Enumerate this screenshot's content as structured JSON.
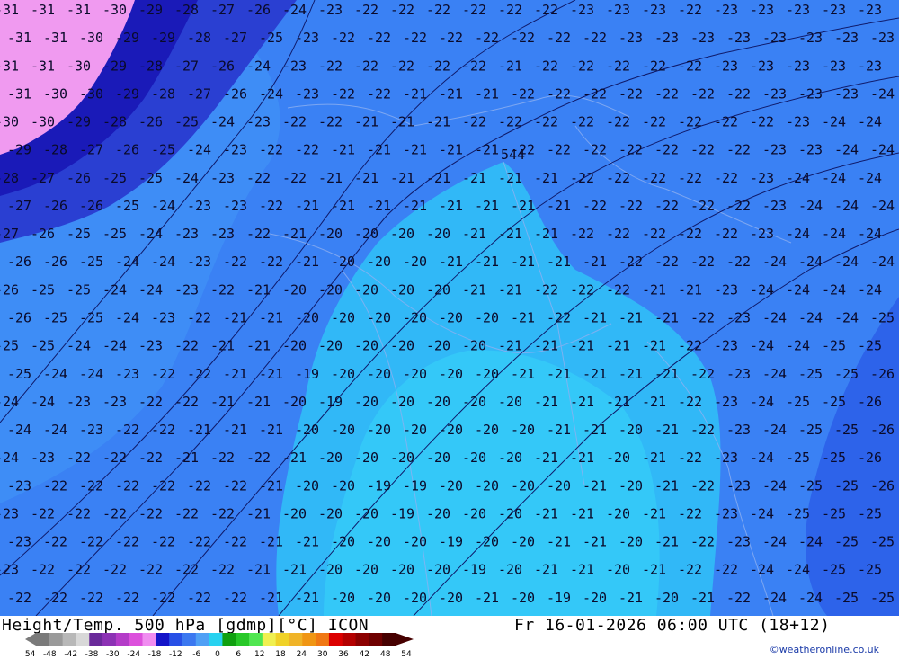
{
  "title": {
    "left": "Height/Temp. 500 hPa [gdmp][°C] ICON",
    "right": "Fr 16-01-2026 06:00 UTC (18+12)"
  },
  "credit": "©weatheronline.co.uk",
  "map_labels": {
    "center_contour": "544"
  },
  "scale": {
    "ticks": [
      "-54",
      "-48",
      "-42",
      "-38",
      "-30",
      "-24",
      "-18",
      "-12",
      "-6",
      "0",
      "6",
      "12",
      "18",
      "24",
      "30",
      "36",
      "42",
      "48",
      "54"
    ],
    "colors": [
      "#7a7a7a",
      "#9a9a9a",
      "#b8b8b8",
      "#d8d8d8",
      "#6a2a9a",
      "#8c32b4",
      "#b43cc8",
      "#dc50dc",
      "#f08cf0",
      "#1414c8",
      "#2850e6",
      "#3c78f0",
      "#50a0f5",
      "#28d2f0",
      "#10a010",
      "#28c828",
      "#50e650",
      "#f0f050",
      "#f0d228",
      "#f0b428",
      "#f09614",
      "#f07814",
      "#dc0000",
      "#b40000",
      "#8c0000",
      "#6e0000",
      "#460000"
    ]
  },
  "temperature_field": {
    "unit": "°C",
    "rows": [
      [
        "31",
        "31",
        "31",
        "30",
        "29",
        "28",
        "27",
        "26",
        "24",
        "23",
        "22",
        "22",
        "22",
        "22",
        "22",
        "22",
        "23",
        "23",
        "23",
        "22",
        "23",
        "23",
        "23",
        "23",
        "23"
      ],
      [
        "31",
        "31",
        "30",
        "29",
        "29",
        "28",
        "27",
        "25",
        "23",
        "22",
        "22",
        "22",
        "22",
        "22",
        "22",
        "22",
        "22",
        "23",
        "23",
        "23",
        "23",
        "23",
        "23",
        "23",
        "23"
      ],
      [
        "31",
        "31",
        "30",
        "29",
        "28",
        "27",
        "26",
        "24",
        "23",
        "22",
        "22",
        "22",
        "22",
        "22",
        "21",
        "22",
        "22",
        "22",
        "22",
        "22",
        "23",
        "23",
        "23",
        "23",
        "23"
      ],
      [
        "31",
        "30",
        "30",
        "29",
        "28",
        "27",
        "26",
        "24",
        "23",
        "22",
        "22",
        "21",
        "21",
        "21",
        "22",
        "22",
        "22",
        "22",
        "22",
        "22",
        "22",
        "23",
        "23",
        "23",
        "24"
      ],
      [
        "30",
        "30",
        "29",
        "28",
        "26",
        "25",
        "24",
        "23",
        "22",
        "22",
        "21",
        "21",
        "21",
        "22",
        "22",
        "22",
        "22",
        "22",
        "22",
        "22",
        "22",
        "22",
        "23",
        "24",
        "24"
      ],
      [
        "29",
        "28",
        "27",
        "26",
        "25",
        "24",
        "23",
        "22",
        "22",
        "21",
        "21",
        "21",
        "21",
        "21",
        "22",
        "22",
        "22",
        "22",
        "22",
        "22",
        "22",
        "23",
        "23",
        "24",
        "24"
      ],
      [
        "28",
        "27",
        "26",
        "25",
        "25",
        "24",
        "23",
        "22",
        "22",
        "21",
        "21",
        "21",
        "21",
        "21",
        "21",
        "21",
        "22",
        "22",
        "22",
        "22",
        "22",
        "23",
        "24",
        "24",
        "24"
      ],
      [
        "27",
        "26",
        "26",
        "25",
        "24",
        "23",
        "23",
        "22",
        "21",
        "21",
        "21",
        "21",
        "21",
        "21",
        "21",
        "21",
        "22",
        "22",
        "22",
        "22",
        "22",
        "23",
        "24",
        "24",
        "24"
      ],
      [
        "27",
        "26",
        "25",
        "25",
        "24",
        "23",
        "23",
        "22",
        "21",
        "20",
        "20",
        "20",
        "20",
        "21",
        "21",
        "21",
        "22",
        "22",
        "22",
        "22",
        "22",
        "23",
        "24",
        "24",
        "24"
      ],
      [
        "26",
        "26",
        "25",
        "24",
        "24",
        "23",
        "22",
        "22",
        "21",
        "20",
        "20",
        "20",
        "21",
        "21",
        "21",
        "21",
        "21",
        "22",
        "22",
        "22",
        "22",
        "24",
        "24",
        "24",
        "24"
      ],
      [
        "26",
        "25",
        "25",
        "24",
        "24",
        "23",
        "22",
        "21",
        "20",
        "20",
        "20",
        "20",
        "20",
        "21",
        "21",
        "22",
        "22",
        "22",
        "21",
        "21",
        "23",
        "24",
        "24",
        "24",
        "24"
      ],
      [
        "26",
        "25",
        "25",
        "24",
        "23",
        "22",
        "21",
        "21",
        "20",
        "20",
        "20",
        "20",
        "20",
        "20",
        "21",
        "22",
        "21",
        "21",
        "21",
        "22",
        "23",
        "24",
        "24",
        "24",
        "25"
      ],
      [
        "25",
        "25",
        "24",
        "24",
        "23",
        "22",
        "21",
        "21",
        "20",
        "20",
        "20",
        "20",
        "20",
        "20",
        "21",
        "21",
        "21",
        "21",
        "21",
        "22",
        "23",
        "24",
        "24",
        "25",
        "25"
      ],
      [
        "25",
        "24",
        "24",
        "23",
        "22",
        "22",
        "21",
        "21",
        "19",
        "20",
        "20",
        "20",
        "20",
        "20",
        "21",
        "21",
        "21",
        "21",
        "21",
        "22",
        "23",
        "24",
        "25",
        "25",
        "26"
      ],
      [
        "24",
        "24",
        "23",
        "23",
        "22",
        "22",
        "21",
        "21",
        "20",
        "19",
        "20",
        "20",
        "20",
        "20",
        "20",
        "21",
        "21",
        "21",
        "21",
        "22",
        "23",
        "24",
        "25",
        "25",
        "26"
      ],
      [
        "24",
        "24",
        "23",
        "22",
        "22",
        "21",
        "21",
        "21",
        "20",
        "20",
        "20",
        "20",
        "20",
        "20",
        "20",
        "21",
        "21",
        "20",
        "21",
        "22",
        "23",
        "24",
        "25",
        "25",
        "26"
      ],
      [
        "24",
        "23",
        "22",
        "22",
        "22",
        "21",
        "22",
        "22",
        "21",
        "20",
        "20",
        "20",
        "20",
        "20",
        "20",
        "21",
        "21",
        "20",
        "21",
        "22",
        "23",
        "24",
        "25",
        "25",
        "26"
      ],
      [
        "23",
        "22",
        "22",
        "22",
        "22",
        "22",
        "22",
        "21",
        "20",
        "20",
        "19",
        "19",
        "20",
        "20",
        "20",
        "20",
        "21",
        "20",
        "21",
        "22",
        "23",
        "24",
        "25",
        "25",
        "26"
      ],
      [
        "23",
        "22",
        "22",
        "22",
        "22",
        "22",
        "22",
        "21",
        "20",
        "20",
        "20",
        "19",
        "20",
        "20",
        "20",
        "21",
        "21",
        "20",
        "21",
        "22",
        "23",
        "24",
        "25",
        "25",
        "25"
      ],
      [
        "23",
        "22",
        "22",
        "22",
        "22",
        "22",
        "22",
        "21",
        "21",
        "20",
        "20",
        "20",
        "19",
        "20",
        "20",
        "21",
        "21",
        "20",
        "21",
        "22",
        "23",
        "24",
        "24",
        "25",
        "25"
      ],
      [
        "23",
        "22",
        "22",
        "22",
        "22",
        "22",
        "22",
        "21",
        "21",
        "20",
        "20",
        "20",
        "20",
        "19",
        "20",
        "21",
        "21",
        "20",
        "21",
        "22",
        "22",
        "24",
        "24",
        "25",
        "25"
      ],
      [
        "22",
        "22",
        "22",
        "22",
        "22",
        "22",
        "22",
        "21",
        "21",
        "20",
        "20",
        "20",
        "20",
        "21",
        "20",
        "19",
        "20",
        "21",
        "20",
        "21",
        "22",
        "24",
        "24",
        "25",
        "25"
      ]
    ]
  }
}
